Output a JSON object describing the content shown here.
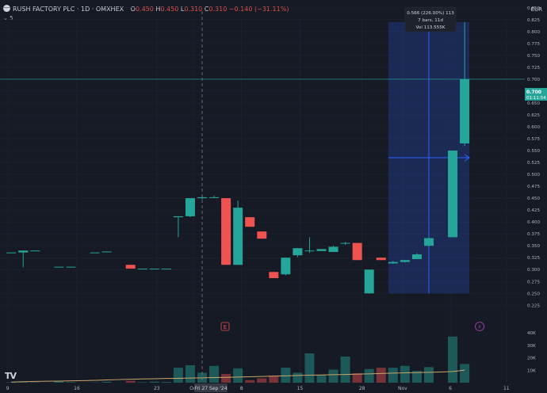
{
  "header": {
    "symbol": "RUSH FACTORY PLC · 1D · OMXHEX",
    "o_label": "O",
    "o_value": "0.450",
    "h_label": "H",
    "h_value": "0.450",
    "l_label": "L",
    "l_value": "0.310",
    "c_label": "C",
    "c_value": "0.310",
    "change": "−0.140 (−31.11%)",
    "collapse": "⌄ 5"
  },
  "currency": "EUR",
  "tooltip": {
    "line1": "0.566 (226.00%) 113",
    "line2": "7 bars, 11d",
    "line3": "Vol 113.555K"
  },
  "last_price": {
    "value": "0.700",
    "countdown": "01:11:54"
  },
  "crosshair_date": "Fri 27 Sep '24",
  "markers": {
    "earnings": "E",
    "dividend": "⚡"
  },
  "tv_logo": "TV",
  "colors": {
    "background": "#161a25",
    "up": "#26a69a",
    "down": "#ef5350",
    "measure": "#2962ff",
    "grid": "#222633"
  },
  "chart_data": {
    "type": "candlestick",
    "price_axis": {
      "range": [
        0.2,
        0.875
      ],
      "ticks": [
        "0.850",
        "0.825",
        "0.800",
        "0.775",
        "0.750",
        "0.725",
        "0.700",
        "0.675",
        "0.650",
        "0.625",
        "0.600",
        "0.575",
        "0.550",
        "0.525",
        "0.500",
        "0.475",
        "0.450",
        "0.425",
        "0.400",
        "0.375",
        "0.350",
        "0.325",
        "0.300",
        "0.275",
        "0.250",
        "0.225"
      ]
    },
    "volume_axis": {
      "range": [
        0,
        45000
      ],
      "ticks": [
        {
          "v": 40000,
          "label": "40K"
        },
        {
          "v": 30000,
          "label": "30K"
        },
        {
          "v": 20000,
          "label": "20K"
        },
        {
          "v": 10000,
          "label": "10K"
        }
      ]
    },
    "time_ticks": [
      "9",
      "16",
      "23",
      "Oct",
      "8",
      "15",
      "28",
      "Nov",
      "6",
      "11"
    ],
    "time_tick_positions": [
      -0.3,
      5.5,
      12.2,
      15.3,
      19.3,
      24.2,
      29.4,
      32.8,
      36.8,
      41.5
    ],
    "volume_ma": [
      500,
      800,
      1000,
      1200,
      1300,
      1500,
      1700,
      1900,
      2200,
      2500,
      2800,
      3000,
      3200,
      3400,
      3500,
      3700,
      3900,
      4100,
      4300,
      4500,
      4800,
      5000,
      5300,
      5500,
      5800,
      6000,
      6200,
      6400,
      6600,
      6900,
      7100,
      7400,
      7700,
      7900,
      8100,
      8300,
      8600,
      9000,
      10100
    ],
    "candles": [
      {
        "o": 0.336,
        "h": 0.336,
        "l": 0.336,
        "c": 0.336,
        "v": 300
      },
      {
        "o": 0.336,
        "h": 0.34,
        "l": 0.305,
        "c": 0.34,
        "v": 500
      },
      {
        "o": 0.34,
        "h": 0.34,
        "l": 0.34,
        "c": 0.34,
        "v": 400
      },
      {
        "o": 0.306,
        "h": 0.306,
        "l": 0.306,
        "c": 0.306,
        "v": 1000
      },
      {
        "o": 0.306,
        "h": 0.306,
        "l": 0.306,
        "c": 0.306,
        "v": 500
      },
      {
        "o": 0.336,
        "h": 0.336,
        "l": 0.336,
        "c": 0.336,
        "v": 200
      },
      {
        "o": 0.338,
        "h": 0.338,
        "l": 0.338,
        "c": 0.338,
        "v": 800
      },
      {
        "o": 0.31,
        "h": 0.31,
        "l": 0.302,
        "c": 0.302,
        "v": 1500
      },
      {
        "o": 0.302,
        "h": 0.302,
        "l": 0.302,
        "c": 0.302,
        "v": 400
      },
      {
        "o": 0.302,
        "h": 0.302,
        "l": 0.302,
        "c": 0.302,
        "v": 900
      },
      {
        "o": 0.302,
        "h": 0.302,
        "l": 0.302,
        "c": 0.302,
        "v": 600
      },
      {
        "o": 0.41,
        "h": 0.41,
        "l": 0.368,
        "c": 0.412,
        "v": 12000
      },
      {
        "o": 0.412,
        "h": 0.45,
        "l": 0.41,
        "c": 0.45,
        "v": 14000
      },
      {
        "o": 0.45,
        "h": 0.455,
        "l": 0.448,
        "c": 0.452,
        "v": 8000
      },
      {
        "o": 0.452,
        "h": 0.455,
        "l": 0.45,
        "c": 0.452,
        "v": 13500
      },
      {
        "o": 0.45,
        "h": 0.45,
        "l": 0.31,
        "c": 0.31,
        "v": 7000
      },
      {
        "o": 0.31,
        "h": 0.445,
        "l": 0.31,
        "c": 0.43,
        "v": 11500
      },
      {
        "o": 0.41,
        "h": 0.41,
        "l": 0.39,
        "c": 0.39,
        "v": 2000
      },
      {
        "o": 0.38,
        "h": 0.38,
        "l": 0.365,
        "c": 0.365,
        "v": 3500
      },
      {
        "o": 0.295,
        "h": 0.295,
        "l": 0.282,
        "c": 0.282,
        "v": 5500
      },
      {
        "o": 0.29,
        "h": 0.325,
        "l": 0.288,
        "c": 0.325,
        "v": 12000
      },
      {
        "o": 0.33,
        "h": 0.345,
        "l": 0.326,
        "c": 0.345,
        "v": 8000
      },
      {
        "o": 0.34,
        "h": 0.368,
        "l": 0.335,
        "c": 0.34,
        "v": 23500
      },
      {
        "o": 0.339,
        "h": 0.343,
        "l": 0.339,
        "c": 0.343,
        "v": 6000
      },
      {
        "o": 0.337,
        "h": 0.35,
        "l": 0.337,
        "c": 0.348,
        "v": 10500
      },
      {
        "o": 0.355,
        "h": 0.358,
        "l": 0.352,
        "c": 0.356,
        "v": 21000
      },
      {
        "o": 0.356,
        "h": 0.356,
        "l": 0.32,
        "c": 0.32,
        "v": 7500
      },
      {
        "o": 0.25,
        "h": 0.3,
        "l": 0.25,
        "c": 0.3,
        "v": 11000
      },
      {
        "o": 0.325,
        "h": 0.325,
        "l": 0.32,
        "c": 0.32,
        "v": 12000
      },
      {
        "o": 0.313,
        "h": 0.318,
        "l": 0.312,
        "c": 0.316,
        "v": 12000
      },
      {
        "o": 0.316,
        "h": 0.32,
        "l": 0.315,
        "c": 0.32,
        "v": 13500
      },
      {
        "o": 0.322,
        "h": 0.335,
        "l": 0.322,
        "c": 0.332,
        "v": 9500
      },
      {
        "o": 0.35,
        "h": 0.368,
        "l": 0.348,
        "c": 0.366,
        "v": 12500
      },
      {
        "o": 0.368,
        "h": 0.55,
        "l": 0.368,
        "c": 0.55,
        "v": 37000
      },
      {
        "o": 0.565,
        "h": 0.82,
        "l": 0.56,
        "c": 0.7,
        "v": 15000
      }
    ],
    "candle_indices": [
      0,
      1,
      2,
      4,
      5,
      7,
      8,
      10,
      11,
      12,
      13,
      14,
      15,
      16,
      17,
      18,
      19,
      20,
      21,
      22,
      23,
      24,
      25,
      26,
      27,
      28,
      29,
      30,
      31,
      32,
      33,
      34,
      35,
      37,
      38
    ],
    "measure": {
      "from_index": 32,
      "to_index": 38,
      "price_from": 0.25,
      "price_to": 0.82,
      "change": 0.566,
      "change_pct": 226.0
    },
    "crosshair_index": 16,
    "last_price": 0.7
  }
}
